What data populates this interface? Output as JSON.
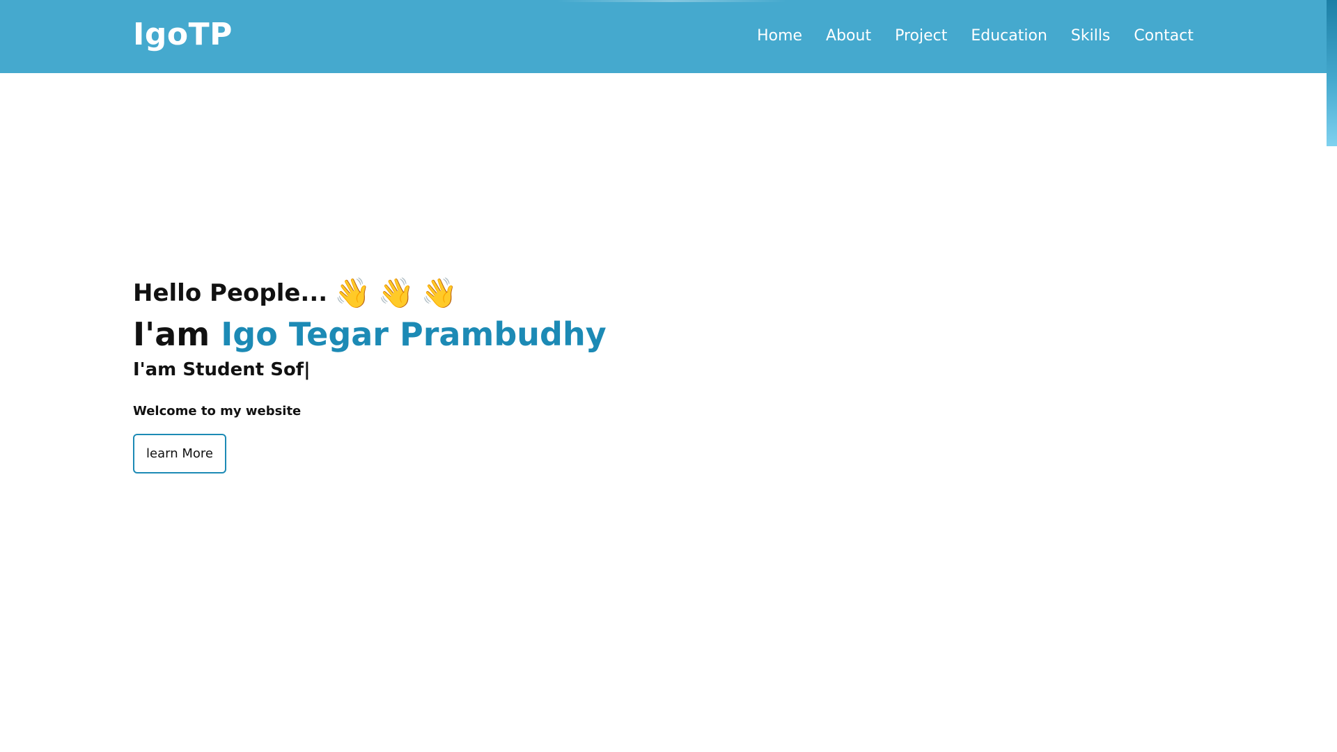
{
  "brand": {
    "title": "IgoTP"
  },
  "nav": {
    "items": [
      {
        "label": "Home"
      },
      {
        "label": "About"
      },
      {
        "label": "Project"
      },
      {
        "label": "Education"
      },
      {
        "label": "Skills"
      },
      {
        "label": "Contact"
      }
    ]
  },
  "hero": {
    "greeting": "Hello People...",
    "wave_icons": [
      "👋",
      "👋",
      "👋"
    ],
    "intro_prefix": "I'am ",
    "intro_name": "Igo Tegar Prambudhy",
    "typing_text": "I'am Student Sof|",
    "welcome": "Welcome to my website",
    "button_label": "learn More"
  },
  "colors": {
    "header_bg": "#45a9ce",
    "accent": "#1c8ab5",
    "text": "#111111",
    "background": "#ffffff"
  }
}
